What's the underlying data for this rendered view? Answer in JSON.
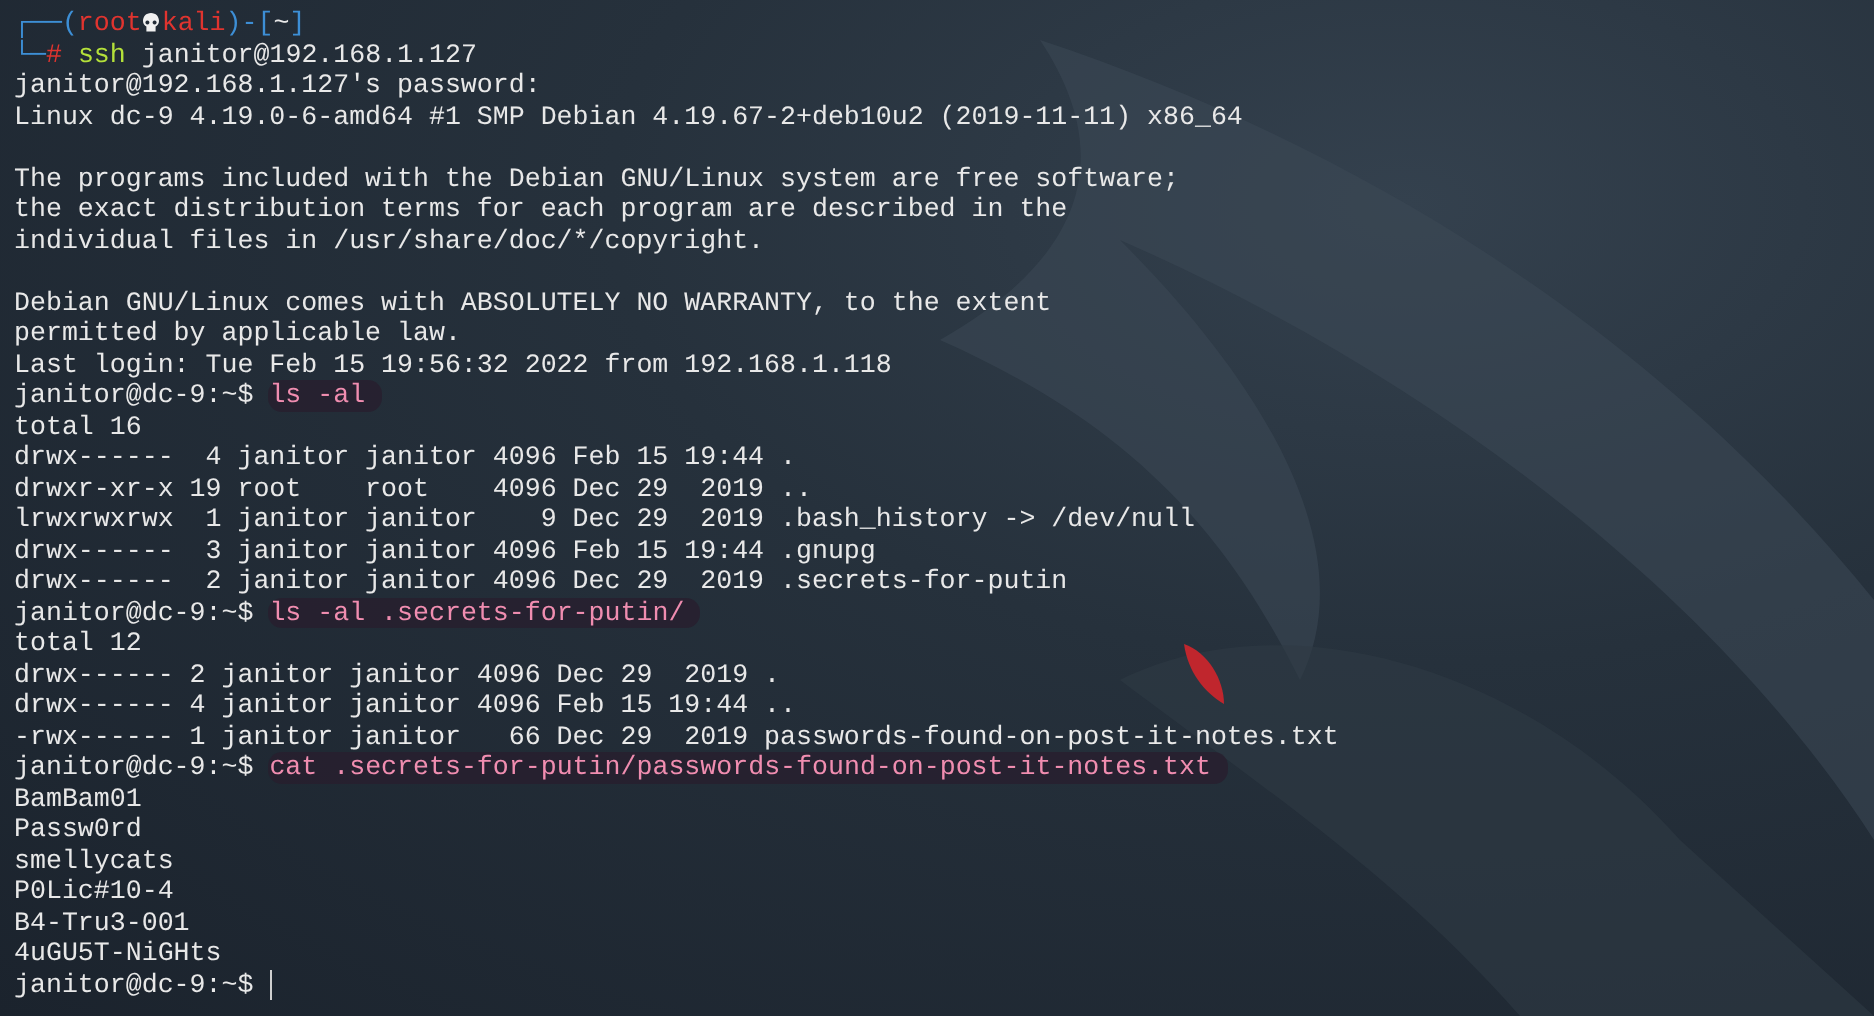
{
  "terminal": {
    "header": {
      "open": "┌──(",
      "user": "root",
      "host": "kali",
      "mid": ")-[",
      "dir": "~",
      "close": "]",
      "corner": "└─",
      "symbol": "#",
      "command_name": "ssh",
      "command_args": "janitor@192.168.1.127"
    },
    "lines": [
      {
        "kind": "output",
        "text": "janitor@192.168.1.127's password:"
      },
      {
        "kind": "output",
        "text": "Linux dc-9 4.19.0-6-amd64 #1 SMP Debian 4.19.67-2+deb10u2 (2019-11-11) x86_64"
      },
      {
        "kind": "blank"
      },
      {
        "kind": "output",
        "text": "The programs included with the Debian GNU/Linux system are free software;"
      },
      {
        "kind": "output",
        "text": "the exact distribution terms for each program are described in the"
      },
      {
        "kind": "output",
        "text": "individual files in /usr/share/doc/*/copyright."
      },
      {
        "kind": "blank"
      },
      {
        "kind": "output",
        "text": "Debian GNU/Linux comes with ABSOLUTELY NO WARRANTY, to the extent"
      },
      {
        "kind": "output",
        "text": "permitted by applicable law."
      },
      {
        "kind": "output",
        "text": "Last login: Tue Feb 15 19:56:32 2022 from 192.168.1.118"
      },
      {
        "kind": "command",
        "prompt": "janitor@dc-9:~$",
        "command": "ls -al"
      },
      {
        "kind": "output",
        "text": "total 16"
      },
      {
        "kind": "output",
        "text": "drwx------  4 janitor janitor 4096 Feb 15 19:44 ."
      },
      {
        "kind": "output",
        "text": "drwxr-xr-x 19 root    root    4096 Dec 29  2019 .."
      },
      {
        "kind": "output",
        "text": "lrwxrwxrwx  1 janitor janitor    9 Dec 29  2019 .bash_history -> /dev/null"
      },
      {
        "kind": "output",
        "text": "drwx------  3 janitor janitor 4096 Feb 15 19:44 .gnupg"
      },
      {
        "kind": "output",
        "text": "drwx------  2 janitor janitor 4096 Dec 29  2019 .secrets-for-putin"
      },
      {
        "kind": "command",
        "prompt": "janitor@dc-9:~$",
        "command": "ls -al .secrets-for-putin/"
      },
      {
        "kind": "output",
        "text": "total 12"
      },
      {
        "kind": "output",
        "text": "drwx------ 2 janitor janitor 4096 Dec 29  2019 ."
      },
      {
        "kind": "output",
        "text": "drwx------ 4 janitor janitor 4096 Feb 15 19:44 .."
      },
      {
        "kind": "output",
        "text": "-rwx------ 1 janitor janitor   66 Dec 29  2019 passwords-found-on-post-it-notes.txt"
      },
      {
        "kind": "command",
        "prompt": "janitor@dc-9:~$",
        "command": "cat .secrets-for-putin/passwords-found-on-post-it-notes.txt"
      },
      {
        "kind": "output",
        "text": "BamBam01"
      },
      {
        "kind": "output",
        "text": "Passw0rd"
      },
      {
        "kind": "output",
        "text": "smellycats"
      },
      {
        "kind": "output",
        "text": "P0Lic#10-4"
      },
      {
        "kind": "output",
        "text": "B4-Tru3-001"
      },
      {
        "kind": "output",
        "text": "4uGU5T-NiGHts"
      },
      {
        "kind": "cursor",
        "prompt": "janitor@dc-9:~$"
      }
    ]
  }
}
